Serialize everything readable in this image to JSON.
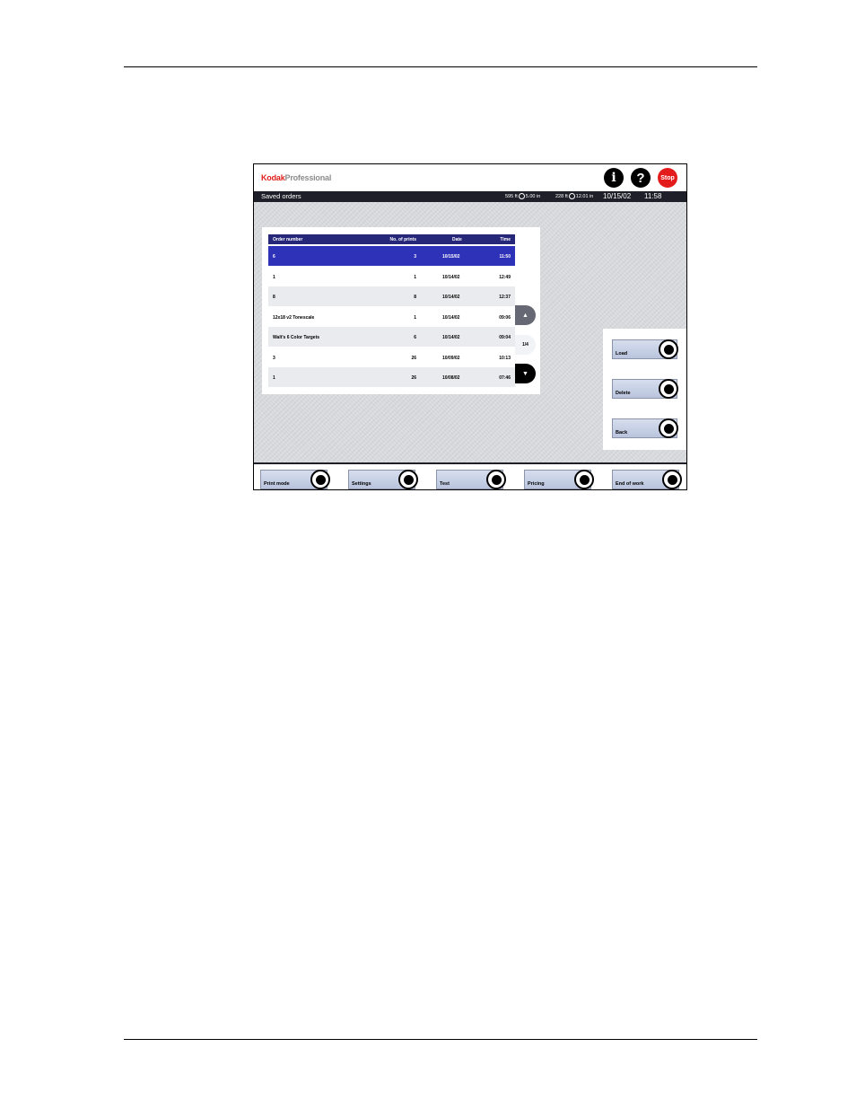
{
  "header": {
    "brand_primary": "Kodak",
    "brand_secondary": "Professional",
    "info_icon": "info-icon",
    "help_icon": "help-icon",
    "stop_label": "Stop",
    "brand_color": "#e0201b"
  },
  "status": {
    "screen_title": "Saved orders",
    "roll1_length": "595 ft",
    "roll1_width": "5.00 in",
    "roll2_length": "228 ft",
    "roll2_width": "12.01 in",
    "date": "10/15/02",
    "time": "11:58"
  },
  "orders_table": {
    "columns": [
      "Order number",
      "No. of prints",
      "Date",
      "Time"
    ],
    "rows": [
      [
        "6",
        "3",
        "10/15/02",
        "11:50"
      ],
      [
        "1",
        "1",
        "10/14/02",
        "12:49"
      ],
      [
        "8",
        "8",
        "10/14/02",
        "12:37"
      ],
      [
        "12x18 v2 Tonescale",
        "1",
        "10/14/02",
        "09:06"
      ],
      [
        "Walt's 6 Color Targets",
        "6",
        "10/14/02",
        "09:04"
      ],
      [
        "3",
        "26",
        "10/09/02",
        "10:13"
      ],
      [
        "1",
        "26",
        "10/08/02",
        "07:46"
      ]
    ],
    "selected_row_index": 0,
    "selected_color": "#2e32b9"
  },
  "pager": {
    "page_indicator": "1/4",
    "up_icon": "page-up-icon",
    "down_icon": "page-down-icon"
  },
  "side_buttons": {
    "load": "Load",
    "delete": "Delete",
    "back": "Back"
  },
  "bottom_buttons": {
    "print_mode": "Print mode",
    "settings": "Settings",
    "test": "Test",
    "pricing": "Pricing",
    "end_of_work": "End of work"
  }
}
